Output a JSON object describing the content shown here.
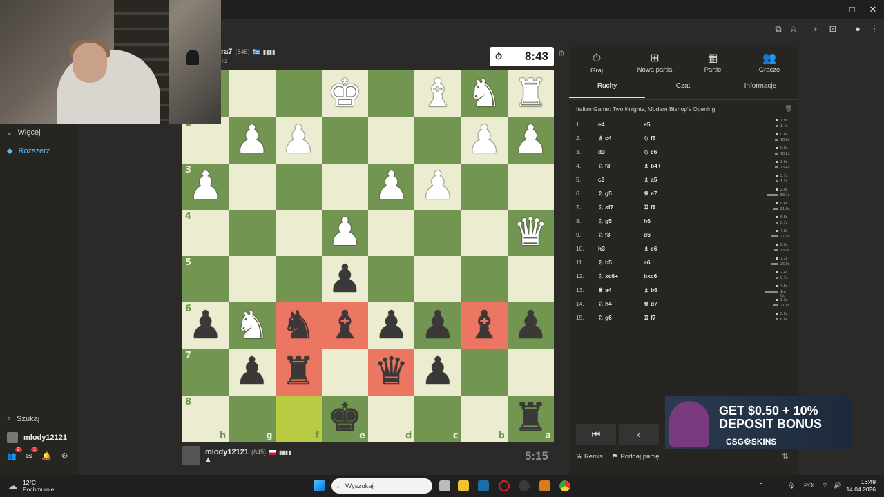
{
  "browser": {
    "window_controls": [
      "—",
      "□",
      "✕"
    ],
    "toolbar_icons": [
      "install-icon",
      "star-icon",
      "extension-icon",
      "puzzle-icon",
      "profile-icon",
      "menu-icon"
    ]
  },
  "sidebar": {
    "more_label": "Więcej",
    "upgrade_label": "Rozszerz",
    "search_label": "Szukaj",
    "username": "mlody12121",
    "notif_count_1": "2",
    "notif_count_2": "1"
  },
  "opponent": {
    "name": "ra7",
    "rating": "(845)",
    "flag": "🇬🇷",
    "bars": "▮▮▮▮",
    "sub": "+1",
    "clock": "8:43"
  },
  "player": {
    "name": "mlody12121",
    "rating": "(845)",
    "bars": "▮▮▮▮",
    "clock": "5:15"
  },
  "board": {
    "rank_labels": [
      "",
      "2",
      "3",
      "4",
      "5",
      "6",
      "7",
      "8"
    ],
    "file_labels": [
      "h",
      "g",
      "f",
      "e",
      "d",
      "c",
      "b",
      "a"
    ],
    "rows": [
      [
        "",
        "",
        "",
        "wK",
        "",
        "wB",
        "wN",
        "wR"
      ],
      [
        "",
        "wP",
        "wP",
        "",
        "",
        "",
        "wP",
        "wP"
      ],
      [
        "wP",
        "",
        "",
        "",
        "wP",
        "wP",
        "",
        ""
      ],
      [
        "",
        "",
        "",
        "wP",
        "",
        "",
        "",
        "wQ"
      ],
      [
        "",
        "",
        "",
        "bP",
        "",
        "",
        "",
        ""
      ],
      [
        "bP",
        "wN",
        "bN",
        "bB",
        "bP",
        "bP",
        "bB",
        "bP"
      ],
      [
        "",
        "bP",
        "bR",
        "",
        "bQ",
        "bP",
        "",
        ""
      ],
      [
        "",
        "",
        "",
        "bK",
        "",
        "",
        "",
        "bR"
      ]
    ],
    "highlights": {
      "5-2": "red",
      "5-3": "red",
      "5-6": "red",
      "6-2": "red",
      "6-4": "red",
      "7-2": "yellow"
    }
  },
  "panel": {
    "tabs": [
      {
        "icon": "⏱",
        "label": "Graj"
      },
      {
        "icon": "⊞",
        "label": "Nowa partia"
      },
      {
        "icon": "▦",
        "label": "Partie"
      },
      {
        "icon": "👥",
        "label": "Gracze"
      }
    ],
    "subtabs": [
      "Ruchy",
      "Czat",
      "Informacje"
    ],
    "opening": "Italian Game: Two Knights, Modern Bishop's Opening",
    "moves": [
      {
        "n": "1.",
        "w": "e4",
        "wi": "",
        "b": "e5",
        "bi": "",
        "t1": "1.9s",
        "t2": "1.4s",
        "f1": 0.05,
        "f2": 0.04
      },
      {
        "n": "2.",
        "w": "c4",
        "wi": "♗",
        "b": "f6",
        "bi": "♘",
        "t1": "0.6s",
        "t2": "10.0s",
        "f1": 0.02,
        "f2": 0.2
      },
      {
        "n": "3.",
        "w": "d3",
        "wi": "",
        "b": "c6",
        "bi": "♘",
        "t1": "0.9s",
        "t2": "10.2s",
        "f1": 0.03,
        "f2": 0.2
      },
      {
        "n": "4.",
        "w": "f3",
        "wi": "♘",
        "b": "b4+",
        "bi": "♗",
        "t1": "3.9s",
        "t2": "13.4s",
        "f1": 0.08,
        "f2": 0.25
      },
      {
        "n": "5.",
        "w": "c3",
        "wi": "",
        "b": "a5",
        "bi": "♗",
        "t1": "3.7s",
        "t2": "1.2s",
        "f1": 0.08,
        "f2": 0.03
      },
      {
        "n": "6.",
        "w": "g5",
        "wi": "♘",
        "b": "e7",
        "bi": "♕",
        "t1": "2.0s",
        "t2": "58.1s",
        "f1": 0.05,
        "f2": 0.9
      },
      {
        "n": "7.",
        "w": "xf7",
        "wi": "♘",
        "b": "f8",
        "bi": "♖",
        "t1": "8.6s",
        "t2": "21.6s",
        "f1": 0.18,
        "f2": 0.4
      },
      {
        "n": "8.",
        "w": "g5",
        "wi": "♘",
        "b": "h6",
        "bi": "",
        "t1": "6.8s",
        "t2": "5.7s",
        "f1": 0.14,
        "f2": 0.12
      },
      {
        "n": "9.",
        "w": "f3",
        "wi": "♘",
        "b": "d6",
        "bi": "",
        "t1": "4.8s",
        "t2": "27.5s",
        "f1": 0.1,
        "f2": 0.5
      },
      {
        "n": "10.",
        "w": "h3",
        "wi": "",
        "b": "e6",
        "bi": "♗",
        "t1": "6.0s",
        "t2": "13.5s",
        "f1": 0.12,
        "f2": 0.26
      },
      {
        "n": "11.",
        "w": "b5",
        "wi": "♘",
        "b": "a6",
        "bi": "",
        "t1": "7.2s",
        "t2": "26.0s",
        "f1": 0.15,
        "f2": 0.48
      },
      {
        "n": "12.",
        "w": "xc6+",
        "wi": "♘",
        "b": "bxc6",
        "bi": "",
        "t1": "2.4s",
        "t2": "0.7s",
        "f1": 0.05,
        "f2": 0.02
      },
      {
        "n": "13.",
        "w": "a4",
        "wi": "♕",
        "b": "b6",
        "bi": "♗",
        "t1": "4.5s",
        "t2": "1m 6s",
        "f1": 0.1,
        "f2": 1.0
      },
      {
        "n": "14.",
        "w": "h4",
        "wi": "♘",
        "b": "d7",
        "bi": "♕",
        "t1": "3.3s",
        "t2": "21.5s",
        "f1": 0.07,
        "f2": 0.4
      },
      {
        "n": "15.",
        "w": "g6",
        "wi": "♘",
        "b": "f7",
        "bi": "♖",
        "t1": "5.5s",
        "t2": "6.8s",
        "f1": 0.11,
        "f2": 0.13
      }
    ],
    "draw_label": "Remis",
    "draw_prefix": "½",
    "resign_label": "Poddaj partię"
  },
  "ad": {
    "line1": "GET $0.50 + 10%",
    "line2": "DEPOSIT BONUS",
    "brand": "CSG⚙SKINS"
  },
  "taskbar": {
    "weather_temp": "12°C",
    "weather_desc": "Pochmurnie",
    "search_placeholder": "Wyszukaj",
    "lang": "POL",
    "time": "16:49",
    "date": "14.04.2026"
  }
}
